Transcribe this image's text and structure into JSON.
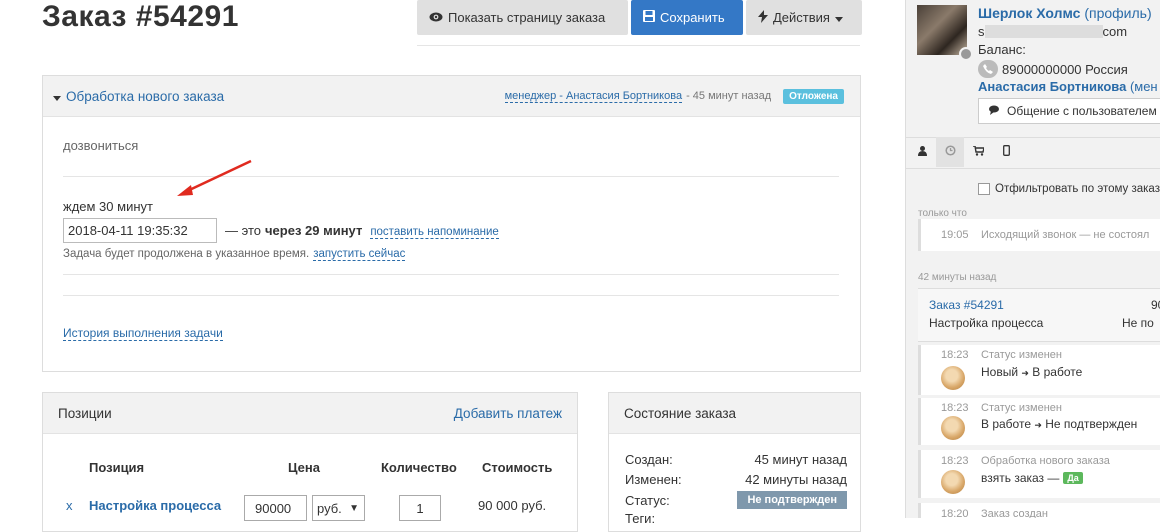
{
  "order": {
    "title": "Заказ #54291"
  },
  "toolbar": {
    "show_page": "Показать страницу заказа",
    "save": "Сохранить",
    "actions": "Действия"
  },
  "task": {
    "title": "Обработка нового заказа",
    "manager": "менеджер - Анастасия Бортникова",
    "time": "- 45 минут назад",
    "status": "Отложена",
    "note": "дозвониться",
    "wait_label": "ждем 30 минут",
    "datetime": "2018-04-11 19:35:32",
    "through_prefix": "— это",
    "through_bold": "через 29 минут",
    "remind_link": "поставить напоминание",
    "continue_text": "Задача будет продолжена в указанное время.",
    "run_now": "запустить сейчас",
    "history_link": "История выполнения задачи"
  },
  "positions": {
    "title": "Позиции",
    "add_payment": "Добавить платеж",
    "columns": [
      "Позиция",
      "Цена",
      "Количество",
      "Стоимость"
    ],
    "rows": [
      {
        "remove": "x",
        "name": "Настройка процесса",
        "price": "90000",
        "currency": "руб.",
        "qty": "1",
        "cost": "90 000 руб."
      }
    ]
  },
  "state": {
    "title": "Состояние заказа",
    "created_label": "Создан:",
    "created_value": "45 минут назад",
    "changed_label": "Изменен:",
    "changed_value": "42 минуты назад",
    "status_label": "Статус:",
    "status_value": "Не подтвержден",
    "tags_label": "Теги:"
  },
  "sidebar": {
    "user_name": "Шерлок Холмс",
    "profile_link": "(профиль)",
    "email_prefix": "s",
    "email_suffix": "com",
    "balance_label": "Баланс:",
    "phone": "89000000000 Россия",
    "manager": "Анастасия Бортникова",
    "manager_suffix": "(мен",
    "chat_button": "Общение с пользователем",
    "filter_label": "Отфильтровать по этому заказ",
    "group1_label": "только что",
    "call_time": "19:05",
    "call_text": "Исходящий звонок — не состоял",
    "group2_label": "42 минуты назад",
    "order_link": "Заказ #54291",
    "order_num_right": "90",
    "order_process": "Настройка процесса",
    "order_process_right": "Не по",
    "events": [
      {
        "time": "18:23",
        "title": "Статус изменен",
        "from": "Новый",
        "to": "В работе"
      },
      {
        "time": "18:23",
        "title": "Статус изменен",
        "from": "В работе",
        "to": "Не подтвержден"
      },
      {
        "time": "18:23",
        "title": "Обработка нового заказа",
        "text": "взять заказ —",
        "badge": "Да"
      },
      {
        "time": "18:20",
        "title": "Заказ создан"
      }
    ]
  },
  "colors": {
    "accent": "#3478c6",
    "link": "#2a6ba8",
    "info": "#5bc0de",
    "status_gray": "#7f98ac",
    "success": "#5cb85c",
    "arrow": "#e02a1f"
  }
}
